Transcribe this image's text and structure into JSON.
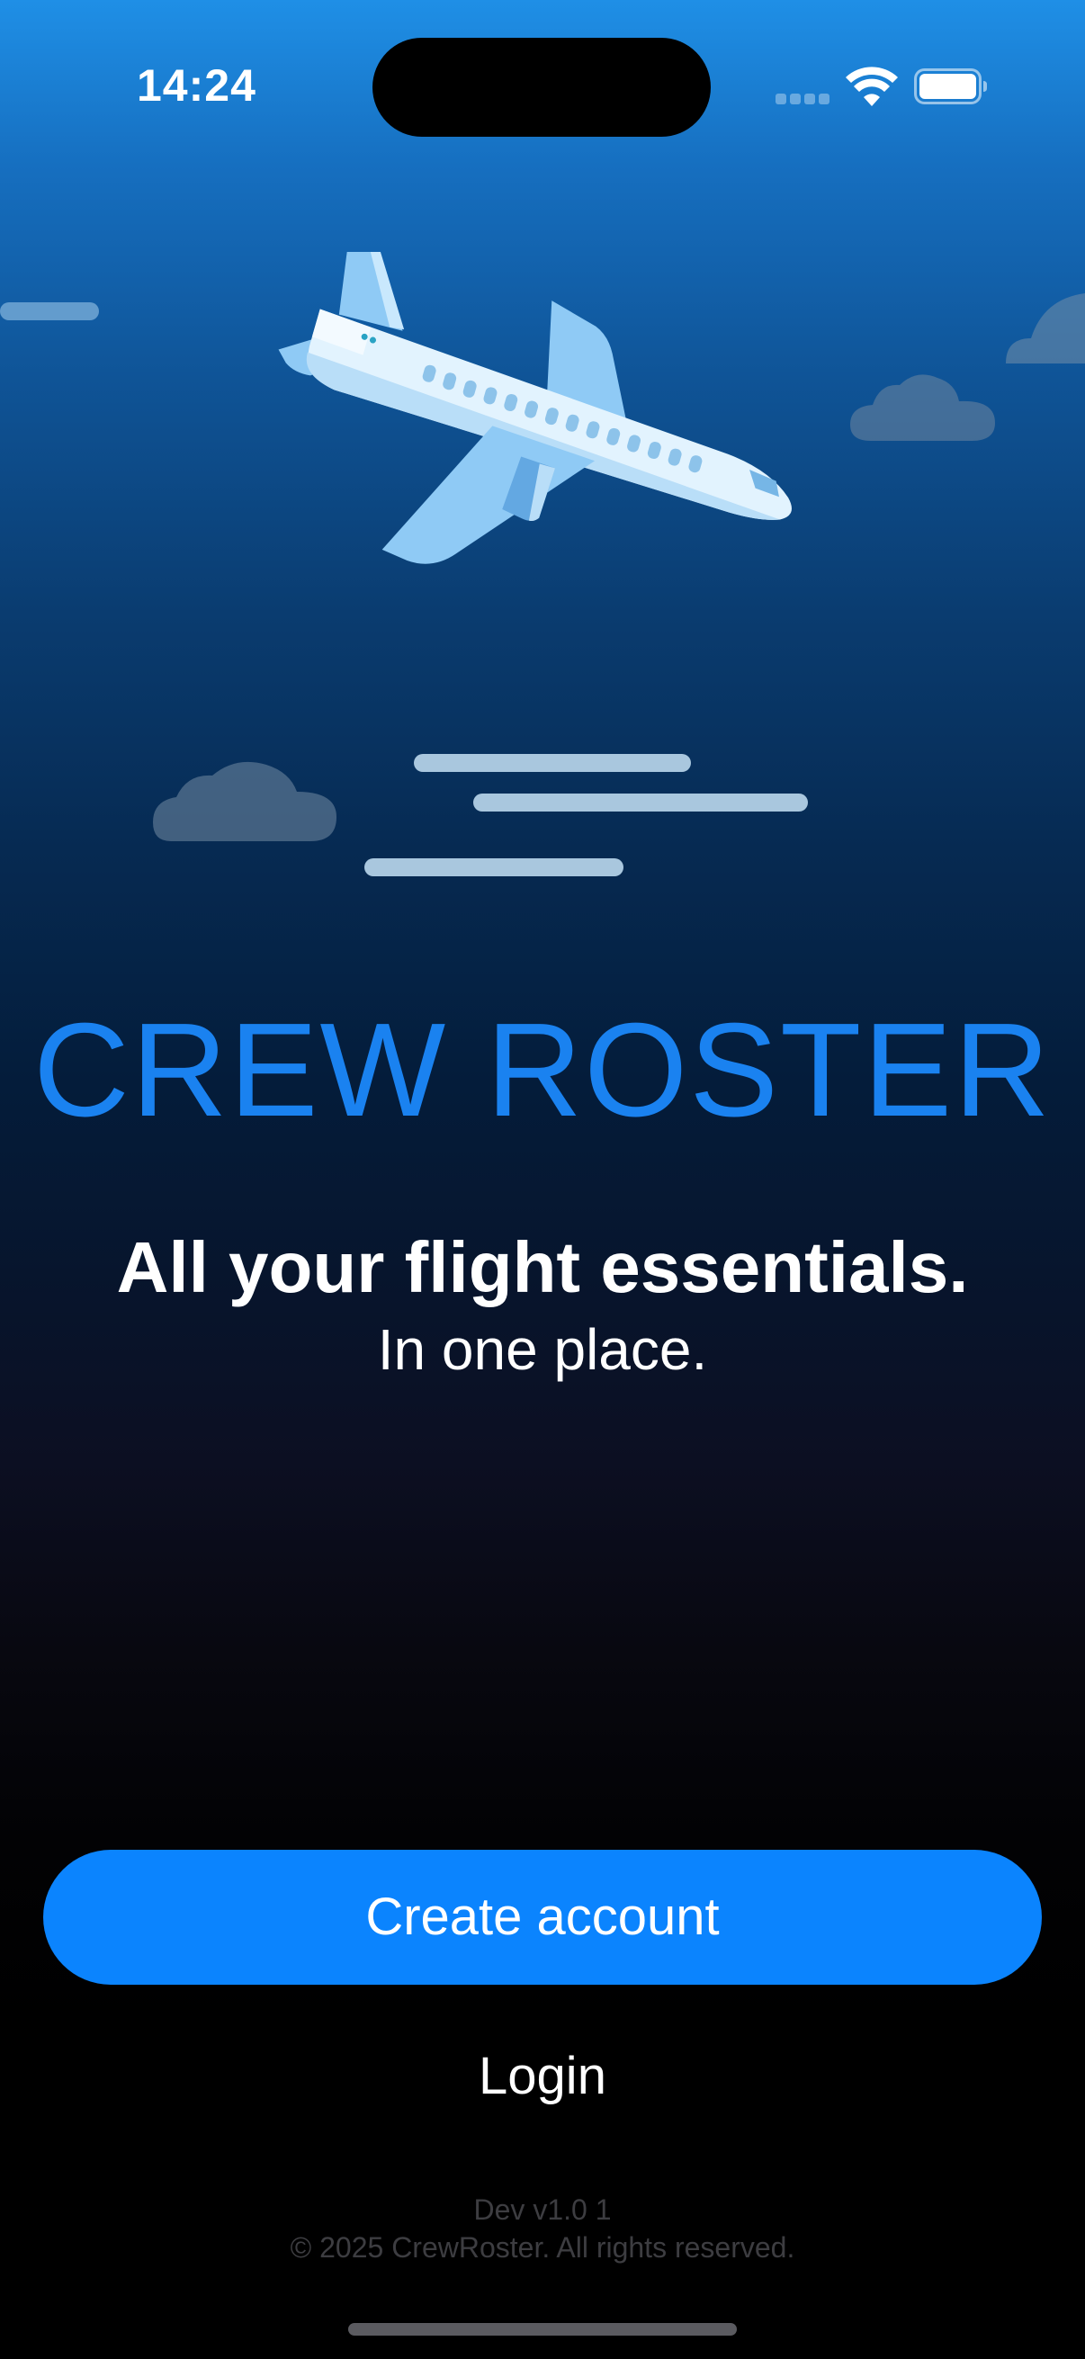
{
  "status_bar": {
    "time": "14:24"
  },
  "app": {
    "title": "CREW ROSTER",
    "headline": "All your flight essentials.",
    "subheadline": "In one place."
  },
  "actions": {
    "create_account_label": "Create account",
    "login_label": "Login"
  },
  "footer": {
    "version": "Dev v1.0 1",
    "copyright": "© 2025 CrewRoster. All rights reserved."
  },
  "colors": {
    "accent": "#0b84fe",
    "title_blue": "#1a82f0",
    "background_top": "#1f8fe6",
    "background_bottom": "#000000"
  },
  "icons": [
    "wifi-icon",
    "battery-icon",
    "cellular-signal-icon",
    "airplane-illustration",
    "cloud-icon"
  ]
}
